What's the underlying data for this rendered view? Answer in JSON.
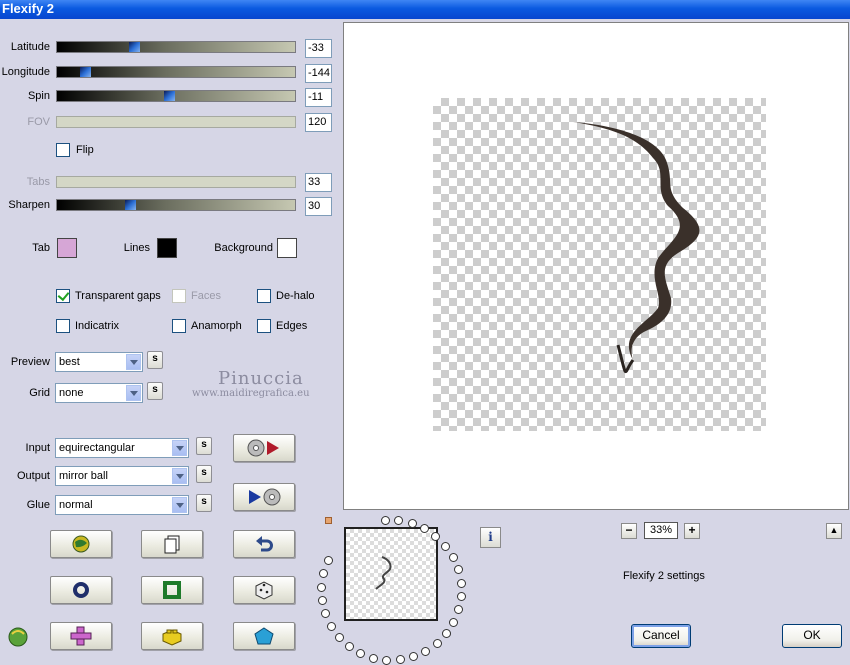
{
  "window": {
    "title": "Flexify 2"
  },
  "params": {
    "latitude": {
      "label": "Latitude",
      "value": "-33"
    },
    "longitude": {
      "label": "Longitude",
      "value": "-144"
    },
    "spin": {
      "label": "Spin",
      "value": "-11"
    },
    "fov": {
      "label": "FOV",
      "value": "120"
    },
    "flip": {
      "label": "Flip",
      "checked": false
    },
    "tabs": {
      "label": "Tabs",
      "value": "33"
    },
    "sharpen": {
      "label": "Sharpen",
      "value": "30"
    }
  },
  "colors": {
    "tab": {
      "label": "Tab",
      "color": "#d6a6d6"
    },
    "lines": {
      "label": "Lines",
      "color": "#000000"
    },
    "background": {
      "label": "Background",
      "color": "#ffffff"
    }
  },
  "options": {
    "transparent_gaps": {
      "label": "Transparent gaps",
      "checked": true
    },
    "faces": {
      "label": "Faces",
      "checked": false
    },
    "de_halo": {
      "label": "De-halo",
      "checked": false
    },
    "indicatrix": {
      "label": "Indicatrix",
      "checked": false
    },
    "anamorph": {
      "label": "Anamorph",
      "checked": false
    },
    "edges": {
      "label": "Edges",
      "checked": false
    }
  },
  "selects": {
    "preview": {
      "label": "Preview",
      "value": "best"
    },
    "grid": {
      "label": "Grid",
      "value": "none"
    },
    "input": {
      "label": "Input",
      "value": "equirectangular"
    },
    "output": {
      "label": "Output",
      "value": "mirror ball"
    },
    "glue": {
      "label": "Glue",
      "value": "normal"
    },
    "s_label": "s"
  },
  "watermark": {
    "line1": "Pinuccia",
    "line2": "www.maidiregrafica.eu"
  },
  "zoom": {
    "minus": "−",
    "value": "33%",
    "plus": "+"
  },
  "status": {
    "text": "Flexify 2 settings",
    "info": "i"
  },
  "buttons": {
    "cancel": "Cancel",
    "ok": "OK"
  }
}
